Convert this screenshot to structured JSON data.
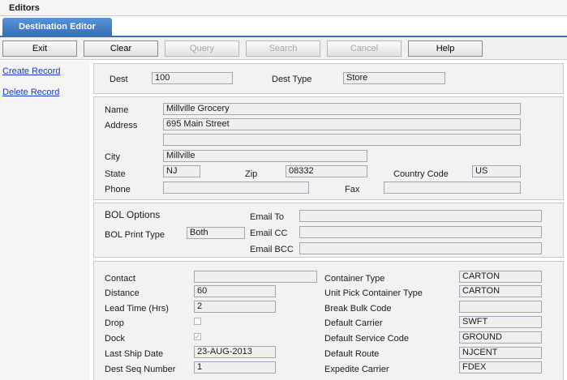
{
  "app": {
    "title": "Editors",
    "tab": "Destination Editor"
  },
  "toolbar": {
    "exit": "Exit",
    "clear": "Clear",
    "query": "Query",
    "search": "Search",
    "cancel": "Cancel",
    "help": "Help"
  },
  "nav": {
    "create": "Create Record",
    "delete": "Delete Record"
  },
  "dest": {
    "dest_label": "Dest",
    "dest_value": "100",
    "type_label": "Dest Type",
    "type_value": "Store"
  },
  "address": {
    "name_label": "Name",
    "name_value": "Millville Grocery",
    "address_label": "Address",
    "address_line1": "695 Main Street",
    "address_line2": "",
    "city_label": "City",
    "city_value": "Millville",
    "state_label": "State",
    "state_value": "NJ",
    "zip_label": "Zip",
    "zip_value": "08332",
    "country_label": "Country Code",
    "country_value": "US",
    "phone_label": "Phone",
    "phone_value": "",
    "fax_label": "Fax",
    "fax_value": ""
  },
  "bol": {
    "title": "BOL Options",
    "print_label": "BOL Print Type",
    "print_value": "Both",
    "email_to_label": "Email To",
    "email_to_value": "",
    "email_cc_label": "Email CC",
    "email_cc_value": "",
    "email_bcc_label": "Email BCC",
    "email_bcc_value": ""
  },
  "details": {
    "contact_label": "Contact",
    "contact_value": "",
    "distance_label": "Distance",
    "distance_value": "60",
    "lead_label": "Lead Time (Hrs)",
    "lead_value": "2",
    "drop_label": "Drop",
    "drop_checked": false,
    "dock_label": "Dock",
    "dock_checked": true,
    "last_ship_label": "Last Ship Date",
    "last_ship_value": "23-AUG-2013",
    "seq_label": "Dest Seq Number",
    "seq_value": "1",
    "container_label": "Container Type",
    "container_value": "CARTON",
    "unit_pick_label": "Unit Pick Container Type",
    "unit_pick_value": "CARTON",
    "break_bulk_label": "Break Bulk Code",
    "break_bulk_value": "",
    "carrier_label": "Default Carrier",
    "carrier_value": "SWFT",
    "service_label": "Default Service Code",
    "service_value": "GROUND",
    "route_label": "Default Route",
    "route_value": "NJCENT",
    "expedite_label": "Expedite Carrier",
    "expedite_value": "FDEX"
  },
  "icons": {
    "checkmark": "✓"
  }
}
